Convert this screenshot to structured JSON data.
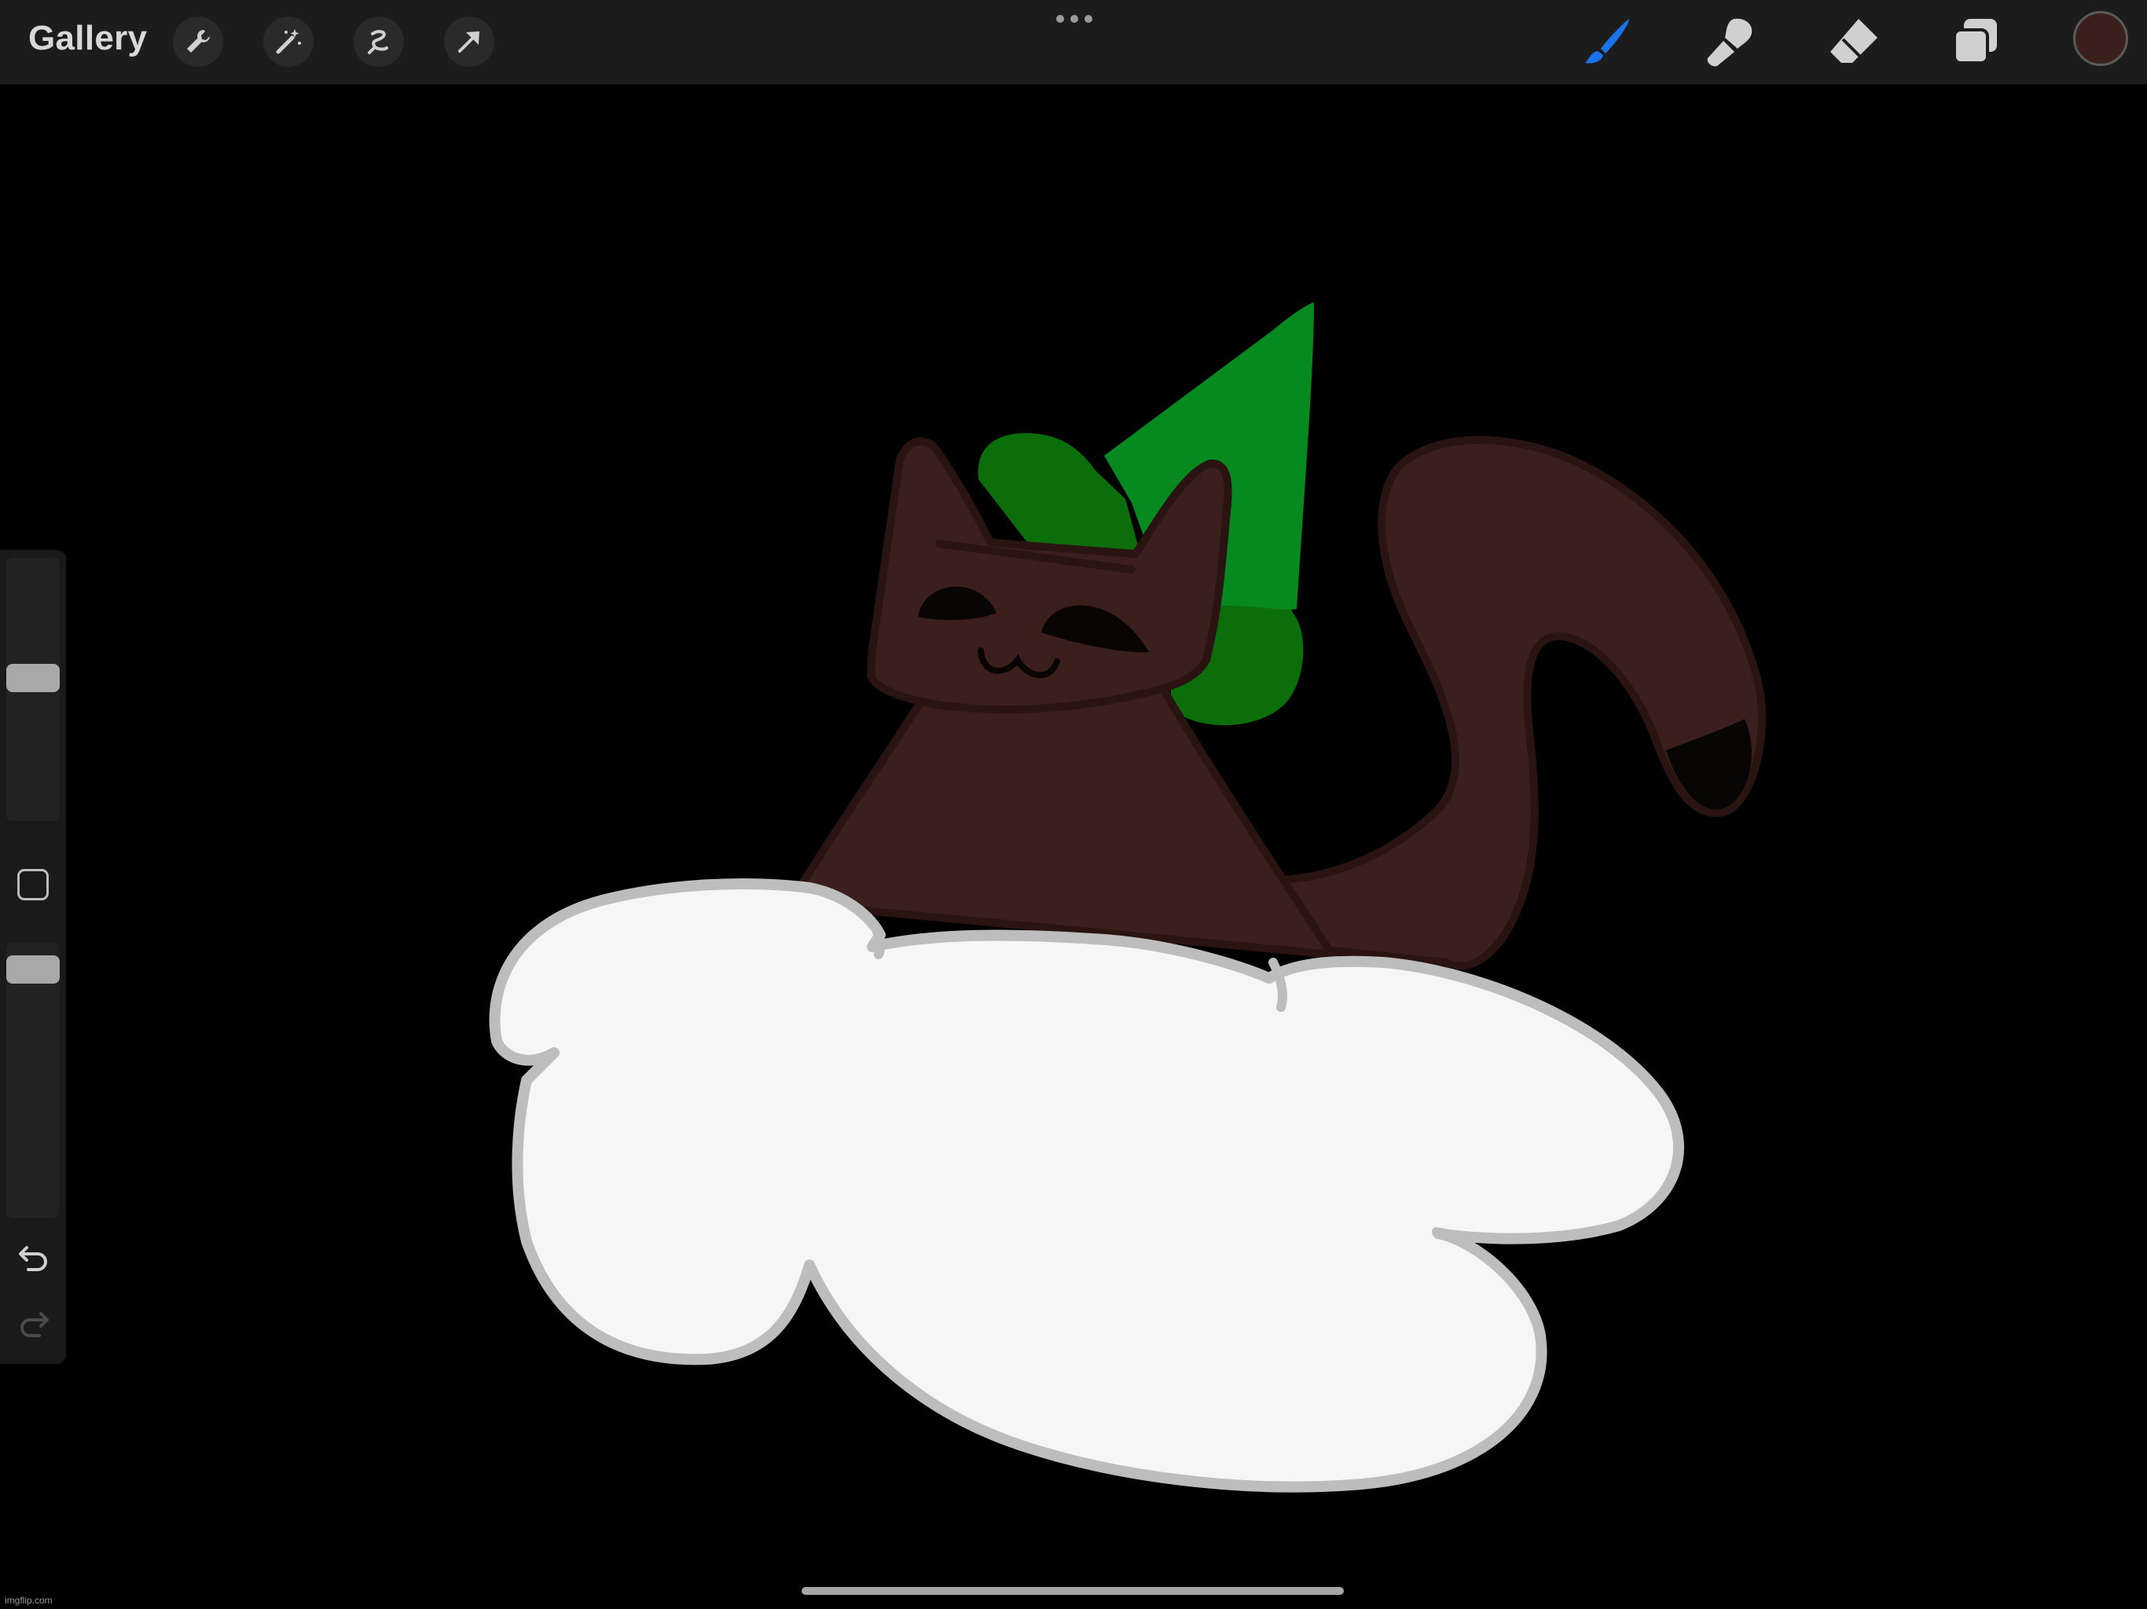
{
  "toolbar": {
    "gallery_label": "Gallery",
    "left_tools": [
      "wrench-icon",
      "magic-wand-icon",
      "selection-icon",
      "transform-arrow-icon"
    ],
    "right_tools": [
      "brush-icon",
      "smudge-icon",
      "eraser-icon",
      "layers-icon"
    ],
    "active_tool": "brush-icon",
    "accent_color": "#1a73e8",
    "current_color": "#3b1f1c"
  },
  "sidebar": {
    "brush_size_level": 0.55,
    "opacity_level": 0.95,
    "undo": "undo-icon",
    "redo": "redo-icon"
  },
  "canvas": {
    "background": "#000000",
    "subject": "brown cat with green party hat on a white cloud"
  },
  "watermark": "imgflip.com"
}
